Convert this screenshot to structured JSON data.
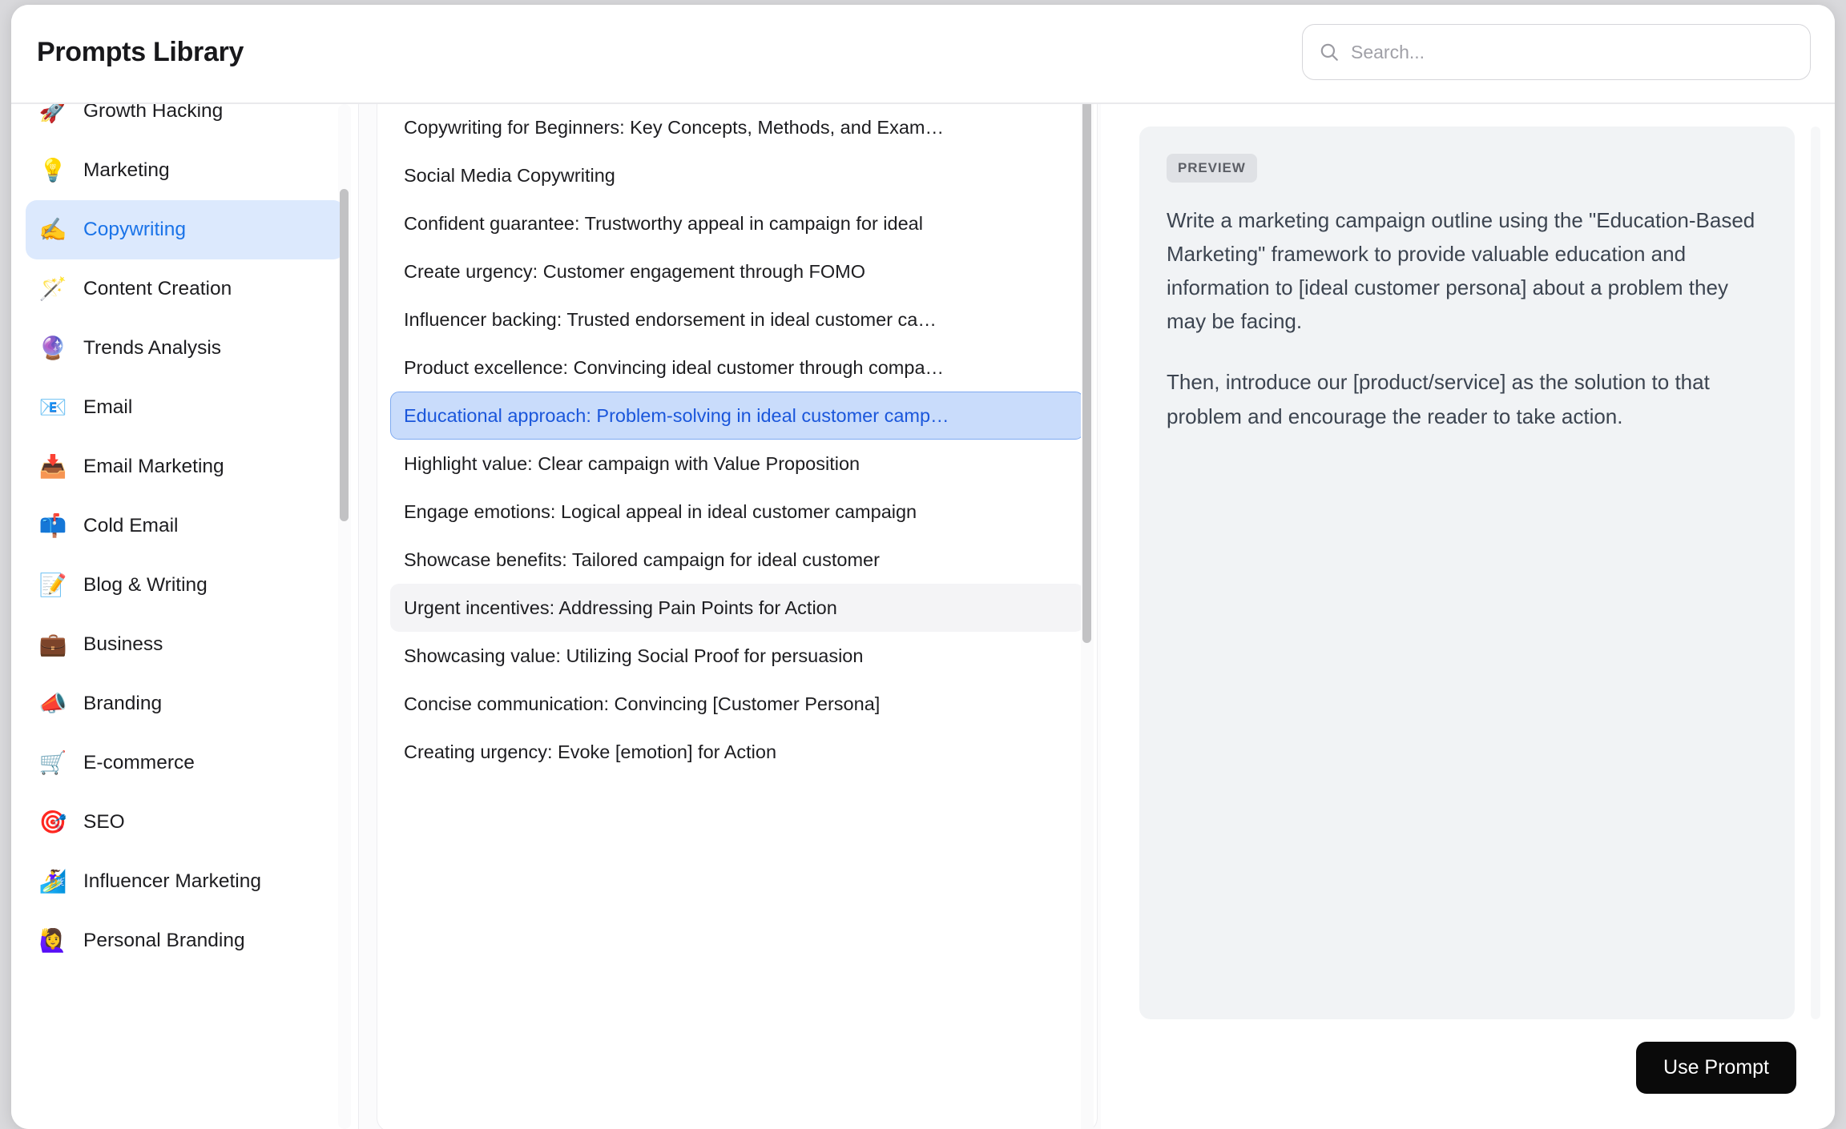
{
  "header": {
    "title": "Prompts Library",
    "search": {
      "placeholder": "Search...",
      "value": "",
      "icon": "search-icon"
    }
  },
  "sidebar": {
    "items": [
      {
        "emoji": "🚀",
        "label": "Growth Hacking",
        "icon": "rocket-icon",
        "active": false
      },
      {
        "emoji": "💡",
        "label": "Marketing",
        "icon": "lightbulb-icon",
        "active": false
      },
      {
        "emoji": "✍️",
        "label": "Copywriting",
        "icon": "writing-hand-icon",
        "active": true
      },
      {
        "emoji": "🪄",
        "label": "Content Creation",
        "icon": "magic-wand-icon",
        "active": false
      },
      {
        "emoji": "🔮",
        "label": "Trends Analysis",
        "icon": "crystal-ball-icon",
        "active": false
      },
      {
        "emoji": "📧",
        "label": "Email",
        "icon": "email-icon",
        "active": false
      },
      {
        "emoji": "📥",
        "label": "Email Marketing",
        "icon": "inbox-tray-icon",
        "active": false
      },
      {
        "emoji": "📫",
        "label": "Cold Email",
        "icon": "mailbox-icon",
        "active": false
      },
      {
        "emoji": "📝",
        "label": "Blog & Writing",
        "icon": "memo-icon",
        "active": false
      },
      {
        "emoji": "💼",
        "label": "Business",
        "icon": "briefcase-icon",
        "active": false
      },
      {
        "emoji": "📣",
        "label": "Branding",
        "icon": "megaphone-icon",
        "active": false
      },
      {
        "emoji": "🛒",
        "label": "E-commerce",
        "icon": "shopping-cart-icon",
        "active": false
      },
      {
        "emoji": "🎯",
        "label": "SEO",
        "icon": "target-icon",
        "active": false
      },
      {
        "emoji": "🏄‍♀️",
        "label": "Influencer Marketing",
        "icon": "surfer-icon",
        "active": false
      },
      {
        "emoji": "🙋‍♀️",
        "label": "Personal Branding",
        "icon": "raising-hand-icon",
        "active": false
      }
    ]
  },
  "prompt_list": {
    "items": [
      {
        "label": "Copywriting for Beginners: Key Concepts, Methods, and Exam…",
        "state": "normal"
      },
      {
        "label": "Social Media Copywriting",
        "state": "normal"
      },
      {
        "label": "Confident guarantee: Trustworthy appeal in campaign for ideal",
        "state": "normal"
      },
      {
        "label": "Create urgency: Customer engagement through FOMO",
        "state": "normal"
      },
      {
        "label": "Influencer backing: Trusted endorsement in ideal customer ca…",
        "state": "normal"
      },
      {
        "label": "Product excellence: Convincing ideal customer through compa…",
        "state": "normal"
      },
      {
        "label": "Educational approach: Problem-solving in ideal customer camp…",
        "state": "selected"
      },
      {
        "label": "Highlight value: Clear campaign with Value Proposition",
        "state": "normal"
      },
      {
        "label": "Engage emotions: Logical appeal in ideal customer campaign",
        "state": "normal"
      },
      {
        "label": "Showcase benefits: Tailored campaign for ideal customer",
        "state": "normal"
      },
      {
        "label": "Urgent incentives: Addressing Pain Points for Action",
        "state": "hover"
      },
      {
        "label": "Showcasing value: Utilizing Social Proof for persuasion",
        "state": "normal"
      },
      {
        "label": "Concise communication: Convincing [Customer Persona]",
        "state": "normal"
      },
      {
        "label": "Creating urgency: Evoke [emotion] for Action",
        "state": "normal"
      }
    ]
  },
  "preview": {
    "badge": "PREVIEW",
    "paragraphs": [
      "Write a marketing campaign outline using the \"Education-Based Marketing\" framework to provide valuable education and information to [ideal customer persona] about a problem they may be facing.",
      "Then, introduce our [product/service] as the solution to that problem and encourage the reader to take action."
    ],
    "use_prompt_label": "Use Prompt"
  },
  "colors": {
    "accent_blue": "#1a73e8",
    "selected_bg": "#c9dcfb",
    "selected_border": "#7faaf0",
    "sidebar_active_bg": "#dce9fd",
    "hover_bg": "#f4f4f6",
    "preview_bg": "#f1f3f5",
    "button_bg": "#0a0a0a",
    "page_bg": "#d9d9dc"
  }
}
